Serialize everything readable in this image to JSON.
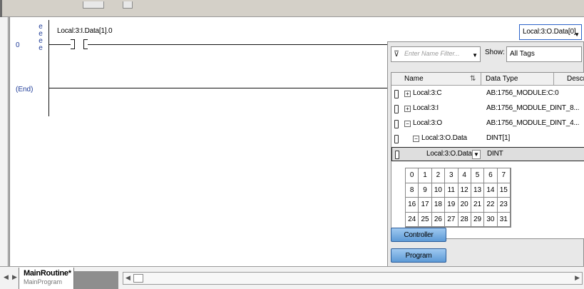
{
  "ladder": {
    "rung_number": "0",
    "end_label": "(End)",
    "edit_markers": [
      "e",
      "e",
      "e",
      "e"
    ],
    "contact_tag": "Local:3:I.Data[1].0",
    "operand_value": "Local:3:O.Data[0]"
  },
  "tag_browser": {
    "filter_placeholder": "Enter Name Filter...",
    "show_label": "Show:",
    "show_value": "All Tags",
    "columns": {
      "name": "Name",
      "type": "Data Type",
      "desc": "Descr"
    },
    "rows": [
      {
        "name": "Local:3:C",
        "type": "AB:1756_MODULE:C:0",
        "expander": "+"
      },
      {
        "name": "Local:3:I",
        "type": "AB:1756_MODULE_DINT_8...",
        "expander": "+"
      },
      {
        "name": "Local:3:O",
        "type": "AB:1756_MODULE_DINT_4...",
        "expander": "−"
      },
      {
        "name": "Local:3:O.Data",
        "type": "DINT[1]",
        "expander": "−"
      },
      {
        "name": "Local:3:O.Data[0]",
        "type": "DINT",
        "expander": ""
      }
    ],
    "bits": [
      "0",
      "1",
      "2",
      "3",
      "4",
      "5",
      "6",
      "7",
      "8",
      "9",
      "10",
      "11",
      "12",
      "13",
      "14",
      "15",
      "16",
      "17",
      "18",
      "19",
      "20",
      "21",
      "22",
      "23",
      "24",
      "25",
      "26",
      "27",
      "28",
      "29",
      "30",
      "31"
    ],
    "scope_buttons": {
      "controller": "Controller",
      "program": "Program"
    }
  },
  "tabs": {
    "active_title": "MainRoutine*",
    "active_subtitle": "MainProgram"
  },
  "icons": {
    "filter": "filter-icon",
    "dropdown": "chevron-down-icon",
    "tag": "tag-icon"
  },
  "colors": {
    "rung_text": "#1f3c98",
    "button_top": "#9fc9f1",
    "button_bottom": "#5d9ad6",
    "selection_border": "#2b63c9"
  }
}
